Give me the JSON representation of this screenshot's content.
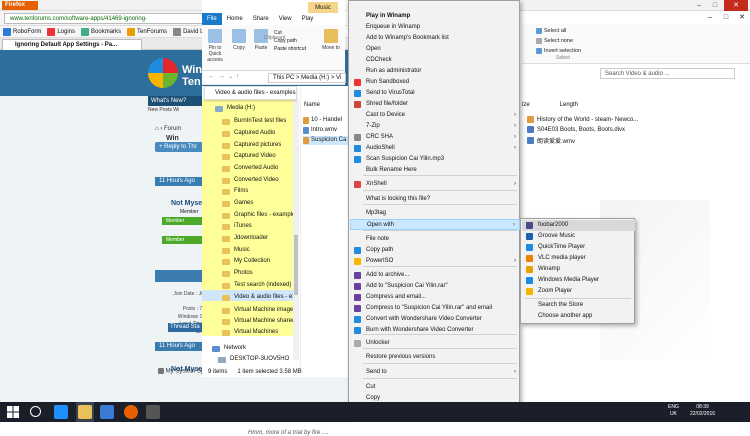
{
  "firefox": {
    "button_label": "Firefox",
    "url": "www.tenforums.com/software-apps/41469-ignoring-",
    "bookmarks": [
      "RoboForm",
      "Logins",
      "Bookmarks",
      "TenForums",
      "David Lawrie"
    ],
    "tab_title": "Ignoring Default App Settings - Pa..."
  },
  "forum": {
    "logo_text": "Windo",
    "logo_text2": "Ten",
    "nav_label": "What's New?",
    "nav_sub": "New Posts  Wi",
    "crumb": "Forum",
    "crumb2": "Win",
    "reply_button": "+ Reply to Thr",
    "post_time_1": "11 Hours Ago",
    "post_time_2": "11 Hours Ago",
    "post_time_3": "11 Hours Ago",
    "user_name_1": "Not Myse",
    "user_name_2": "Not Myse",
    "member_label": "Member",
    "member_badge": "Member",
    "stats": [
      "Join Date : Jul 2",
      "Posts : 74",
      "Windows 10",
      "Local Time: 11:5"
    ],
    "thread_starter": "Thread Sta",
    "system_spec": "My System Spe",
    "quote": "Hmm, more of a trial by fire ...."
  },
  "explorer": {
    "music_tools": "Music Tools",
    "tabs": [
      "File",
      "Home",
      "Share",
      "View",
      "Play"
    ],
    "ribbon": [
      "Pin to Quick access",
      "Copy",
      "Paste"
    ],
    "ribbon_small": [
      "Cut",
      "Copy path",
      "Paste shortcut"
    ],
    "move_to": "Move to",
    "clipboard_label": "Clipboard",
    "address": "This PC > Media (H:) > Vi",
    "nav_popup": "Video & audio files - examples",
    "nav_items": [
      "Media (H:)",
      "BurnInTest test files",
      "Captured Audio",
      "Captured pictures",
      "Captured Video",
      "Converted Audio",
      "Converted Video",
      "Films",
      "Games",
      "Graphic files - example",
      "iTunes",
      "Jdownloader",
      "Music",
      "My Collection",
      "Photos",
      "Test search (indexed)",
      "Video & audio files - ex",
      "Virtual Machine images",
      "Virtual Machine shared",
      "Virtual Machines",
      "Network",
      "DESKTOP-3UOV5HO"
    ],
    "col_name": "Name",
    "files": [
      "10 - Handel",
      "Intro.wmv",
      "Suspicion Ca"
    ],
    "status_items": "9 items",
    "status_selected": "1 item selected  3.58 MB"
  },
  "bg_window": {
    "select_all": "Select all",
    "select_none": "Select none",
    "invert_selection": "Invert selection",
    "select_label": "Select",
    "search_placeholder": "Search Video & audio ...",
    "col_size": "ize",
    "col_length": "Length",
    "rows": [
      "History of the World - steam- Newco...",
      "S04E03 Boots, Boots, Boots.divx",
      "朗读爱爱.wmv"
    ]
  },
  "context_menu": {
    "items": [
      "Play in Winamp",
      "Enqueue in Winamp",
      "Add to Winamp's Bookmark list",
      "Open",
      "CDCheck",
      "Run as administrator",
      "Run Sandboxed",
      "Send to VirusTotal",
      "Shred file/folder",
      "Cast to Device",
      "7-Zip",
      "CRC SHA",
      "AudioShell",
      "Scan Suspicion Cai Yilin.mp3",
      "Bulk Rename Here",
      "XnShell",
      "What is locking this file?",
      "Mp3tag",
      "Open with",
      "File note",
      "Copy path",
      "PowerISO",
      "Add to archive...",
      "Add to \"Suspicion Cai Yilin.rar\"",
      "Compress and email...",
      "Compress to \"Suspicion Cai Yilin.rar\" and email",
      "Convert with Wondershare Video Converter",
      "Burn with Wondershare Video Converter",
      "Unlocker",
      "Restore previous versions",
      "Send to",
      "Cut",
      "Copy"
    ]
  },
  "submenu": {
    "items": [
      "foobar2000",
      "Groove Music",
      "QuickTime Player",
      "VLC media player",
      "Winamp",
      "Windows Media Player",
      "Zoom Player",
      "Search the Store",
      "Choose another app"
    ]
  },
  "taskbar": {
    "lang_line1": "ENG",
    "lang_line2": "UK",
    "time": "08:39",
    "date": "22/02/2016"
  },
  "colors": {
    "accent": "#1979ca",
    "menu_highlight": "#cce8ff",
    "folder_highlight": "#ffff99",
    "firefox": "#e66000"
  }
}
